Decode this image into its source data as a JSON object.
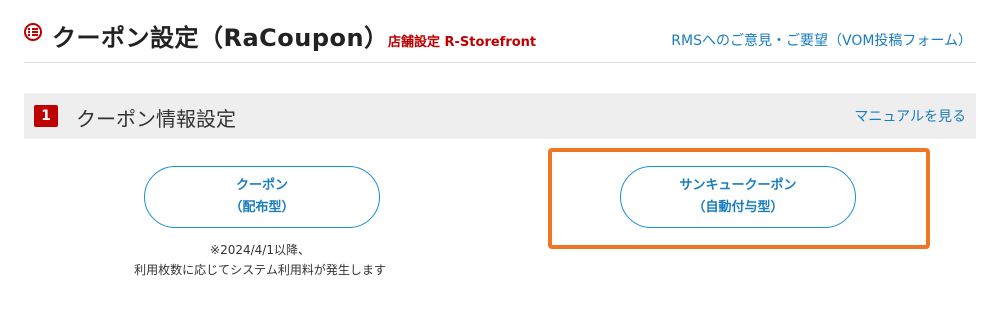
{
  "header": {
    "title": "クーポン設定（RaCoupon）",
    "store_label": "店舗設定 R-Storefront",
    "feedback_link": "RMSへのご意見・ご要望（VOM投稿フォーム）",
    "icon": "list-circle-icon"
  },
  "section": {
    "step_number": "1",
    "title": "クーポン情報設定",
    "manual_link": "マニュアルを見る"
  },
  "coupons": [
    {
      "line1": "クーポン",
      "line2": "（配布型）"
    },
    {
      "line1": "サンキュークーポン",
      "line2": "（自動付与型）"
    }
  ],
  "note": {
    "line1": "※2024/4/1以降、",
    "line2": "利用枚数に応じてシステム利用料が発生します"
  },
  "colors": {
    "brand_red": "#bf0000",
    "link_blue": "#1a7dbf",
    "highlight_orange": "#f07525"
  }
}
